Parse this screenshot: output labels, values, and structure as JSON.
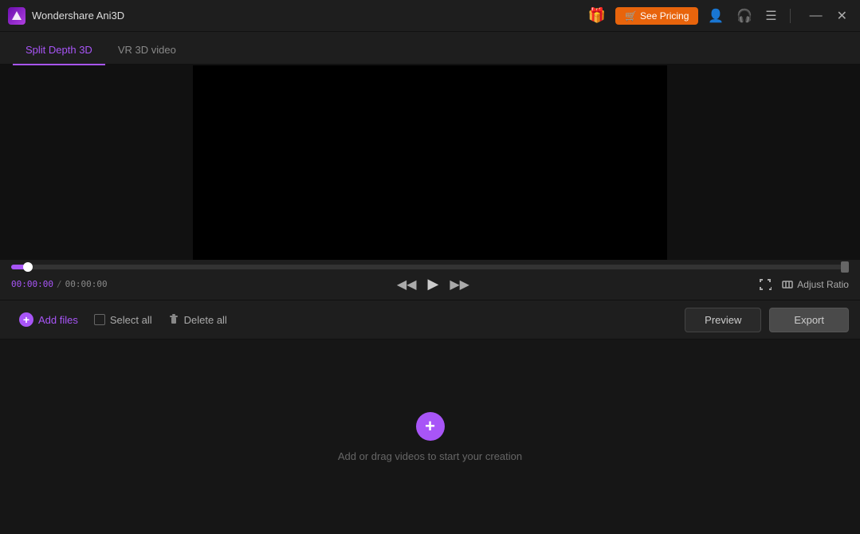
{
  "app": {
    "title": "Wondershare Ani3D",
    "logo_char": "A"
  },
  "titlebar": {
    "gift_icon": "🎁",
    "see_pricing_icon": "🛒",
    "see_pricing_label": "See Pricing",
    "account_icon": "👤",
    "headset_icon": "🎧",
    "menu_icon": "☰",
    "minimize_icon": "—",
    "close_icon": "✕"
  },
  "tabs": [
    {
      "id": "split-depth-3d",
      "label": "Split Depth 3D",
      "active": true
    },
    {
      "id": "vr-3d-video",
      "label": "VR 3D video",
      "active": false
    }
  ],
  "player": {
    "time_current": "00:00:00",
    "time_separator": "/",
    "time_total": "00:00:00",
    "adjust_ratio_label": "Adjust Ratio"
  },
  "toolbar": {
    "add_files_label": "Add files",
    "select_all_label": "Select all",
    "delete_all_label": "Delete all",
    "preview_label": "Preview",
    "export_label": "Export"
  },
  "dropzone": {
    "icon": "+",
    "text": "Add or drag videos to start your creation"
  }
}
